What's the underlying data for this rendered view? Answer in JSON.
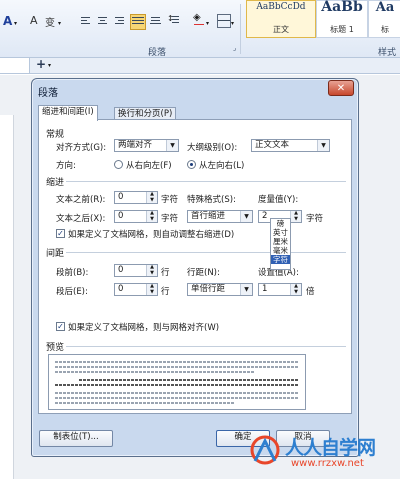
{
  "ribbon": {
    "group_label": "段落",
    "styles_group_label": "样式",
    "styles": [
      {
        "sample": "AaBbCcDd",
        "name": "正文"
      },
      {
        "sample": "AaBb",
        "name": "标题 1"
      },
      {
        "sample": "Aa",
        "name": "标"
      }
    ],
    "font_color_glyph": "A",
    "text_effects_glyph": "A",
    "phonetic_glyph": "变",
    "quick_add_glyph": "+"
  },
  "dialog": {
    "title": "段落",
    "close_glyph": "✕",
    "tabs": [
      {
        "label": "缩进和间距(I)",
        "active": true
      },
      {
        "label": "换行和分页(P)",
        "active": false
      }
    ],
    "general": {
      "section": "常规",
      "alignment_label": "对齐方式(G):",
      "alignment_value": "两端对齐",
      "outline_label": "大纲级别(O):",
      "outline_value": "正文文本",
      "direction_label": "方向:",
      "rtl_label": "从右向左(F)",
      "ltr_label": "从左向右(L)",
      "direction_selected": "ltr"
    },
    "indent": {
      "section": "缩进",
      "before_label": "文本之前(R):",
      "before_value": "0",
      "before_unit": "字符",
      "after_label": "文本之后(X):",
      "after_value": "0",
      "after_unit": "字符",
      "special_label": "特殊格式(S):",
      "special_value": "首行缩进",
      "measure_label": "度量值(Y):",
      "measure_value": "2",
      "measure_unit": "字符",
      "unit_options": [
        "磅",
        "英寸",
        "厘米",
        "毫米",
        "字符"
      ],
      "unit_selected": "字符",
      "auto_adjust_label": "如果定义了文档网格，则自动调整右缩进(D)",
      "auto_adjust_checked": true
    },
    "spacing": {
      "section": "间距",
      "before_label": "段前(B):",
      "before_value": "0",
      "before_unit": "行",
      "after_label": "段后(E):",
      "after_value": "0",
      "after_unit": "行",
      "line_label": "行距(N):",
      "line_value": "单倍行距",
      "setting_label": "设置值(A):",
      "setting_value": "1",
      "setting_unit": "倍",
      "grid_label": "如果定义了文档网格，则与网格对齐(W)",
      "grid_checked": true
    },
    "preview": {
      "section": "预览"
    },
    "buttons": {
      "tabs": "制表位(T)...",
      "ok": "确定",
      "cancel": "取消"
    }
  },
  "watermark": {
    "name": "人人自学网",
    "url": "www.rrzxw.net"
  }
}
